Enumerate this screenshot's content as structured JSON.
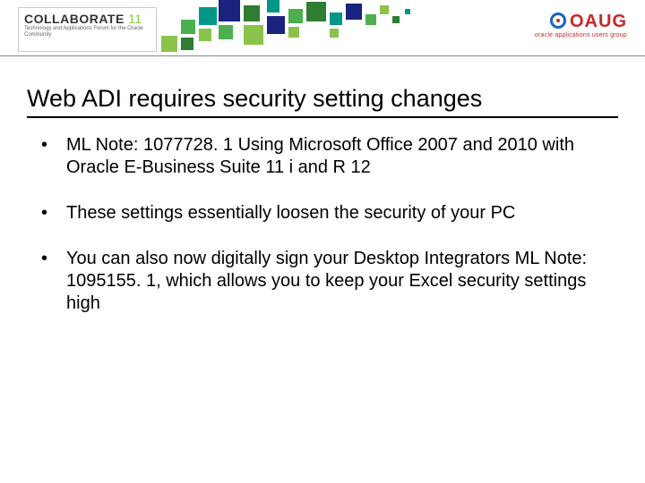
{
  "header": {
    "collab": {
      "main": "COLLABORATE",
      "year": "11",
      "sub": "Technology and Applications Forum for the Oracle Community"
    },
    "oaug": {
      "brand": "OAUG",
      "tag": "oracle applications users group"
    }
  },
  "title": "Web ADI requires security setting changes",
  "bullets": [
    "ML Note: 1077728. 1 Using Microsoft Office 2007 and 2010 with Oracle E-Business Suite 11 i and R 12",
    "These settings essentially loosen the security of your PC",
    "You can also now digitally sign your Desktop Integrators ML Note: 1095155. 1, which allows you to keep your Excel security settings high"
  ],
  "colors": {
    "green1": "#8bc34a",
    "green2": "#4caf50",
    "green3": "#2e7d32",
    "teal": "#009688",
    "navy": "#1a237e"
  }
}
